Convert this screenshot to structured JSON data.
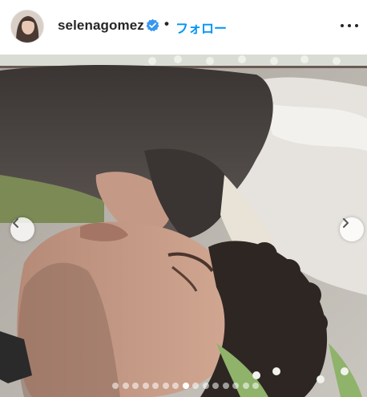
{
  "post_header": {
    "username": "selenagomez",
    "verified_icon": "verified-badge-icon",
    "separator": "•",
    "follow_label": "フォロー",
    "more_icon": "more-options-icon"
  },
  "carousel": {
    "prev_icon": "chevron-left-icon",
    "next_icon": "chevron-right-icon",
    "slide_count": 15,
    "active_index": 7
  },
  "colors": {
    "follow_blue": "#0095f6",
    "verified_blue": "#3897f0",
    "text_dark": "#262626"
  }
}
